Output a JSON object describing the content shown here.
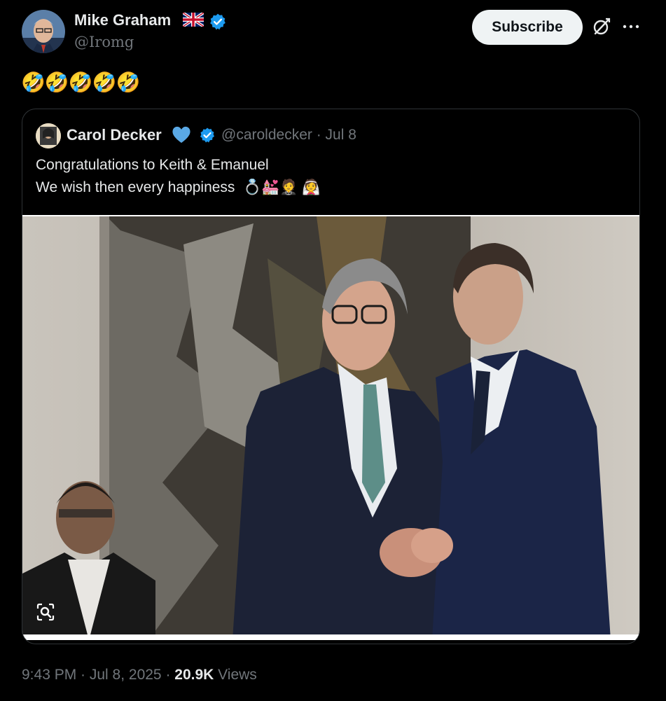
{
  "author": {
    "name": "Mike Graham",
    "handle": "@Iromg",
    "flag_icon": "uk-flag-icon",
    "verified_icon": "verified-badge-icon",
    "verified_color": "#1d9bf0"
  },
  "header": {
    "subscribe_label": "Subscribe",
    "grok_icon": "grok-icon",
    "more_icon": "more-options-icon"
  },
  "tweet": {
    "text": "🤣🤣🤣🤣🤣"
  },
  "quote": {
    "name": "Carol Decker",
    "heart_icon": "blue-heart-icon",
    "handle_date": "@caroldecker · Jul 8",
    "line1": "Congratulations to Keith & Emanuel",
    "line2": "We wish then every happiness  💍💒🤵 👰"
  },
  "footer": {
    "time_date": "9:43 PM · Jul 8, 2025 · ",
    "views_count": "20.9K",
    "views_label": "Views"
  },
  "colors": {
    "background": "#000000",
    "text": "#e7e9ea",
    "secondary": "#71767b",
    "border": "#2f3336",
    "subscribe_bg": "#eff3f4"
  }
}
